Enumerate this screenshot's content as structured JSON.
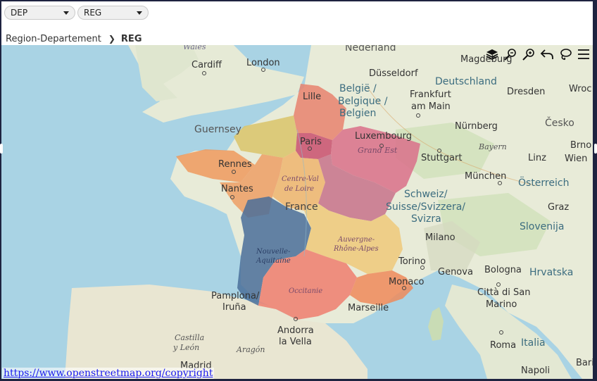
{
  "filters": {
    "dep": {
      "value": "DEP"
    },
    "reg": {
      "value": "REG"
    }
  },
  "breadcrumb": {
    "parent": "Region-Departement",
    "current": "REG"
  },
  "map": {
    "cities": [
      "Wales",
      "London",
      "Cardiff",
      "Nederland",
      "Magdeburg",
      "Düsseldorf",
      "Deutschland",
      "Lille",
      "België /",
      "Belgique /",
      "Belgien",
      "Frankfurt",
      "am Main",
      "Dresden",
      "Wroc",
      "Guernsey",
      "Paris",
      "Luxembourg",
      "Nürnberg",
      "Česko",
      "Grand Est",
      "Bayern",
      "Brno",
      "Stuttgart",
      "Linz",
      "Wien",
      "Rennes",
      "Centre-Val",
      "de Loire",
      "München",
      "Nantes",
      "Schweiz/",
      "Suisse/Svizzera/",
      "Svizra",
      "Österreich",
      "France",
      "Graz",
      "Slovenija",
      "Milano",
      "Nouvelle-",
      "Aquitaine",
      "Auvergne-",
      "Rhône-Alpes",
      "Torino",
      "Genova",
      "Bologna",
      "Hrvatska",
      "Monaco",
      "Pamplona/",
      "Iruña",
      "Occitanie",
      "Città di San",
      "Marino",
      "Marseille",
      "Andorra",
      "la Vella",
      "Italia",
      "Castilla",
      "y León",
      "Aragón",
      "Roma",
      "Madrid",
      "Bari",
      "Napoli"
    ],
    "region_colors": {
      "hauts_de_france": "#e8826e",
      "normandie": "#d9c46a",
      "ile_de_france": "#c9506e",
      "grand_est": "#d9708a",
      "bretagne": "#ee9a5e",
      "pays_de_la_loire": "#ee9a5e",
      "centre_val_de_loire": "#eeb56e",
      "bourgogne": "#c46a86",
      "nouvelle_aquitaine": "#4a6e9a",
      "auvergne_rhone_alpes": "#eec97a",
      "occitanie": "#ee7e6e",
      "paca": "#ee8a5a"
    }
  },
  "toolbar": {
    "icons": [
      "layers-icon",
      "zoom-out-icon",
      "zoom-in-icon",
      "undo-icon",
      "lasso-icon",
      "menu-icon"
    ]
  },
  "copyright": "https://www.openstreetmap.org/copyright"
}
